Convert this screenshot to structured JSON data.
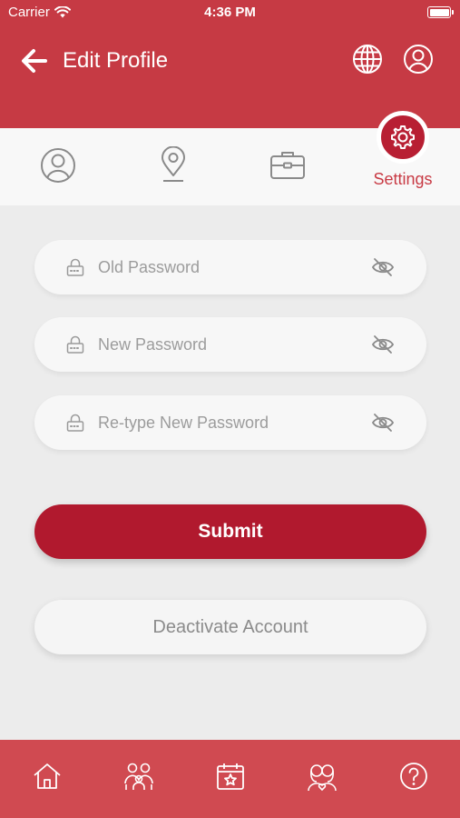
{
  "status_bar": {
    "carrier": "Carrier",
    "time": "4:36 PM"
  },
  "header": {
    "title": "Edit Profile"
  },
  "tabs": [
    {
      "icon": "profile-icon"
    },
    {
      "icon": "location-pin-icon"
    },
    {
      "icon": "briefcase-icon"
    },
    {
      "icon": "gear-icon",
      "label": "Settings",
      "active": true
    }
  ],
  "form": {
    "old_password": {
      "placeholder": "Old Password",
      "value": ""
    },
    "new_password": {
      "placeholder": "New Password",
      "value": ""
    },
    "retype_password": {
      "placeholder": "Re-type New Password",
      "value": ""
    },
    "submit_label": "Submit",
    "deactivate_label": "Deactivate Account"
  },
  "bottom_nav": [
    {
      "icon": "home-icon"
    },
    {
      "icon": "family-icon"
    },
    {
      "icon": "calendar-star-icon"
    },
    {
      "icon": "couple-icon"
    },
    {
      "icon": "help-icon"
    }
  ],
  "colors": {
    "header": "#c63a44",
    "primary": "#b1192e",
    "accent_text": "#c83a44",
    "bottom_nav": "#d04a51",
    "background": "#ececec"
  }
}
